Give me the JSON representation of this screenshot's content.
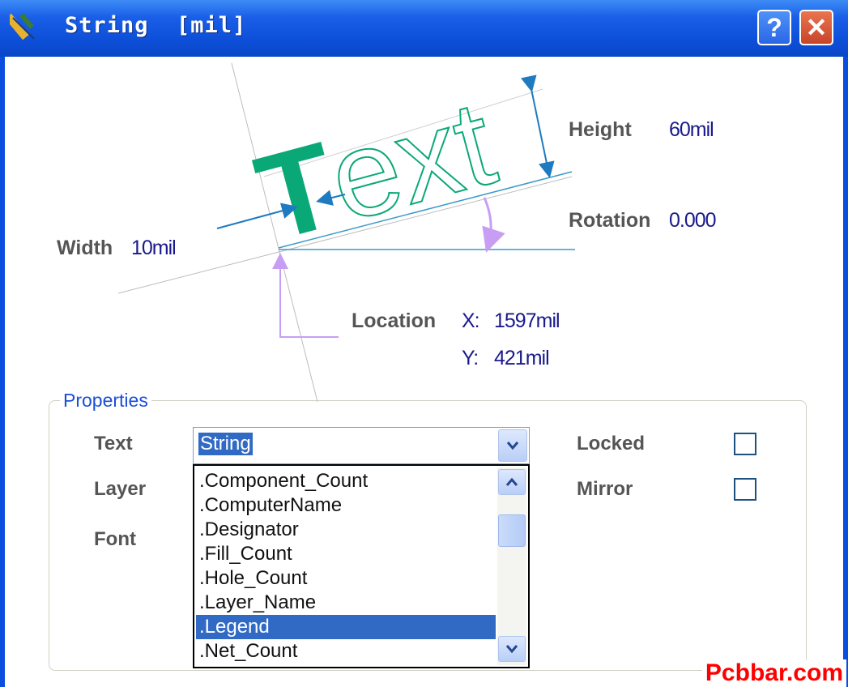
{
  "window": {
    "title": "String  [mil]",
    "help_glyph": "?",
    "close_glyph": "✕"
  },
  "diagram": {
    "sample_text": "Text",
    "height_label": "Height",
    "height_value": "60mil",
    "rotation_label": "Rotation",
    "rotation_value": "0.000",
    "width_label": "Width",
    "width_value": "10mil",
    "location_label": "Location",
    "x_label": "X:",
    "x_value": "1597mil",
    "y_label": "Y:",
    "y_value": "421mil"
  },
  "properties": {
    "group_title": "Properties",
    "text_label": "Text",
    "layer_label": "Layer",
    "font_label": "Font",
    "locked_label": "Locked",
    "mirror_label": "Mirror",
    "locked_checked": false,
    "mirror_checked": false,
    "text_value": "String",
    "dropdown_items": [
      ".Component_Count",
      ".ComputerName",
      ".Designator",
      ".Fill_Count",
      ".Hole_Count",
      ".Layer_Name",
      ".Legend",
      ".Net_Count"
    ],
    "selected_item": ".Legend"
  },
  "watermark": "Pcbbar.com",
  "colors": {
    "titlebar": "#0d4fd9",
    "selection": "#316ac5",
    "text_green": "#0aa877",
    "arrow_blue": "#1f7ac0",
    "arrow_violet": "#c89ef5"
  }
}
